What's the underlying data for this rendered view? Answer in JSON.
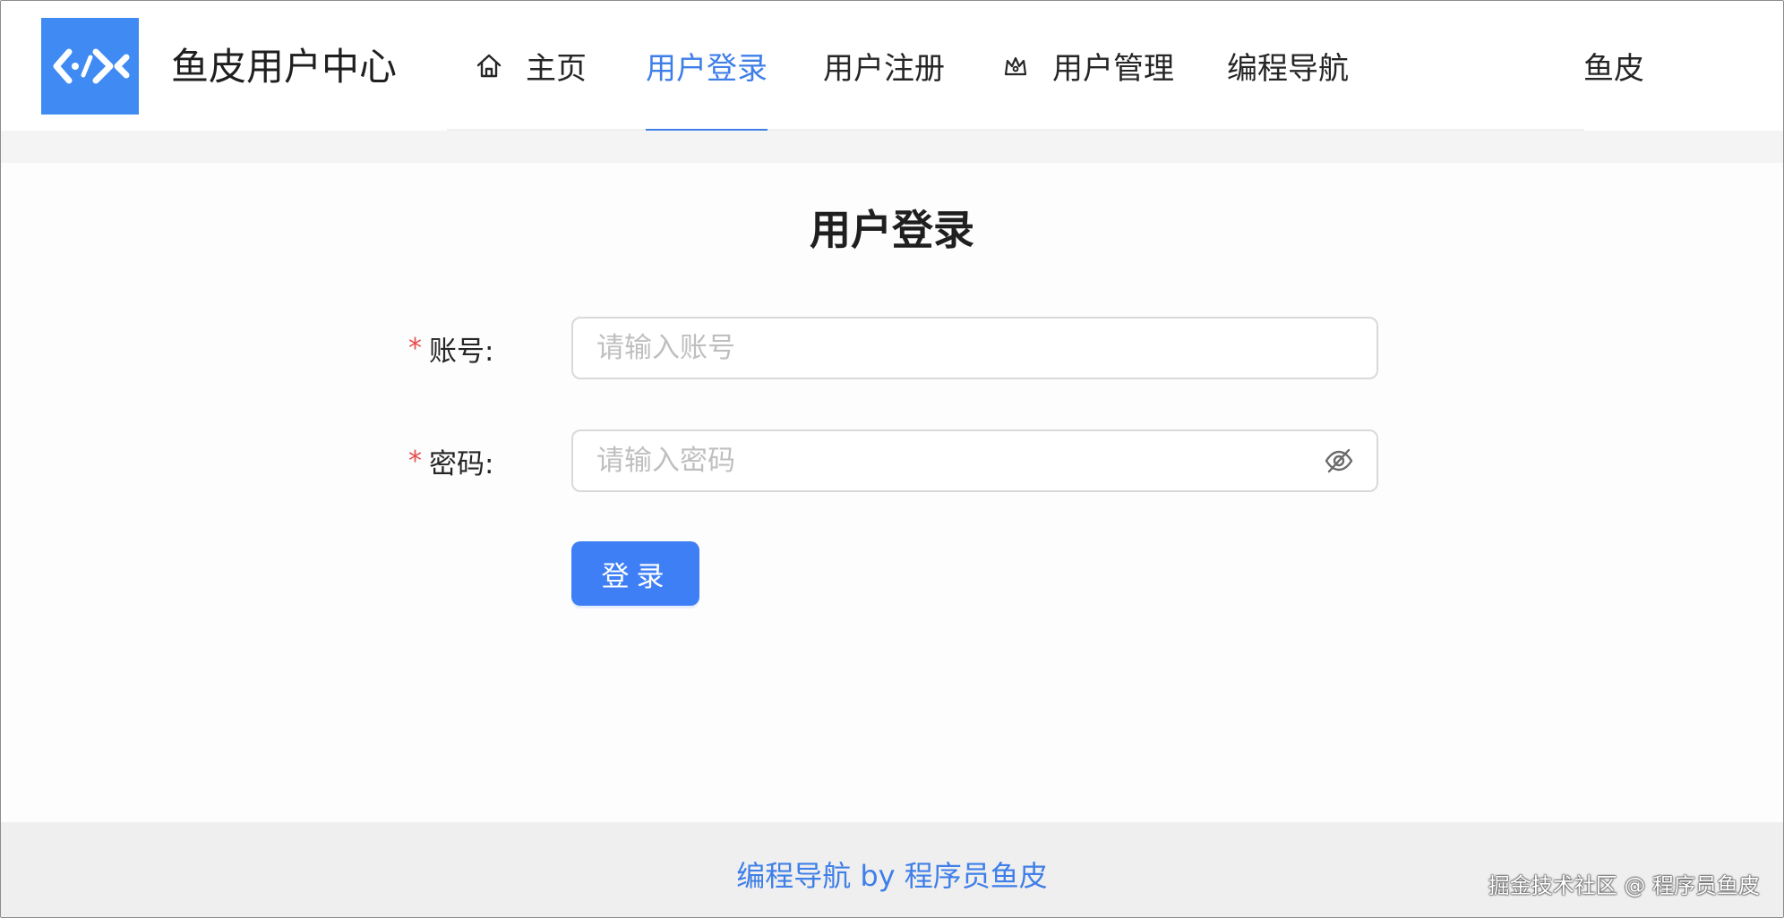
{
  "header": {
    "site_title": "鱼皮用户中心",
    "nav": {
      "home": "主页",
      "login": "用户登录",
      "register": "用户注册",
      "admin": "用户管理",
      "coding_nav": "编程导航"
    },
    "user_name": "鱼皮",
    "active_tab": "login"
  },
  "main": {
    "title": "用户登录",
    "account": {
      "label": "账号:",
      "placeholder": "请输入账号",
      "required": true
    },
    "password": {
      "label": "密码:",
      "placeholder": "请输入密码",
      "required": true
    },
    "login_button": "登录"
  },
  "footer": {
    "link_text": "编程导航 by 程序员鱼皮"
  },
  "watermark": "掘金技术社区 @ 程序员鱼皮",
  "colors": {
    "accent": "#3f7fe8",
    "logo_bg": "#3f8bf3",
    "required": "#e84c4c"
  },
  "icons": {
    "logo": "code-fish-logo",
    "home": "home-icon",
    "admin": "crown-icon",
    "password_toggle": "eye-invisible-icon"
  }
}
